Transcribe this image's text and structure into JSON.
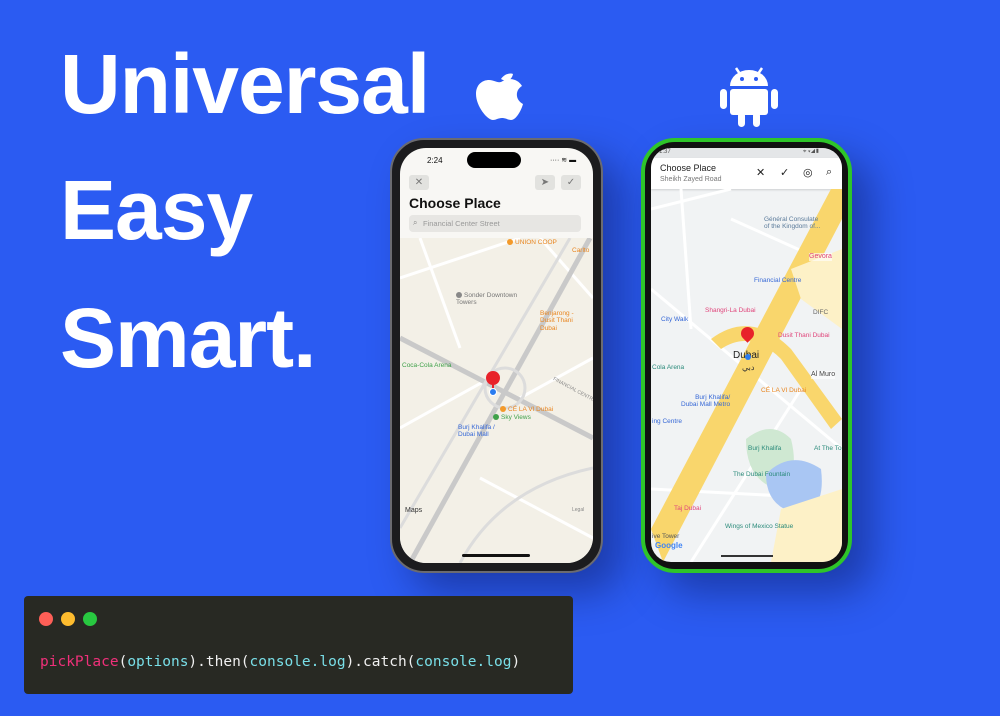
{
  "hero": {
    "lines": [
      "Universal",
      "Easy",
      "Smart."
    ]
  },
  "icons": {
    "apple": "apple-logo-icon",
    "android": "android-logo-icon"
  },
  "colors": {
    "background": "#2b5bf2",
    "android_frame": "#2ec52a",
    "code_bg": "#282923",
    "pin": "#e8222a"
  },
  "ios": {
    "status_time": "2:24",
    "title": "Choose Place",
    "search_placeholder": "Financial Center Street",
    "map_labels": [
      "UNION COOP",
      "Sonder Downtown\nTowers",
      "Benjarong -\nDusit Thani\nDubai",
      "Coca-Cola Arena",
      "CÉ LA VI Dubai",
      "Sky Views",
      "Burj Khalifa /\nDubai Mall",
      "Carlto",
      "FINANCIAL CENTRE"
    ],
    "attribution": "Maps",
    "legal": "Legal"
  },
  "android": {
    "status_time": "1:37",
    "title": "Choose Place",
    "subtitle": "Sheikh Zayed Road",
    "map_labels": [
      "Général Consulate\nof the Kingdom of...",
      "Gevora",
      "Financial Centre",
      "Shangri-La Dubai",
      "DIFC",
      "City Walk",
      "Dusit Thani Dubai",
      "Cola Arena",
      "Al Muro",
      "CÉ LA VI Dubai",
      "Burj Khalifa/\nDubai Mall Metro",
      "ing Centre",
      "Burj Khalifa",
      "At The To",
      "The Dubai Fountain",
      "Taj Dubai",
      "Wings of Mexico Statue",
      "ive Tower"
    ],
    "city": "Dubai",
    "city_ar": "دبي",
    "attribution": "Google"
  },
  "code": {
    "fn": "pickPlace",
    "p1": "(",
    "a1": "options",
    "p2": ").then(",
    "a2": "console.log",
    "p3": ").catch(",
    "a3": "console.log",
    "p4": ")"
  }
}
